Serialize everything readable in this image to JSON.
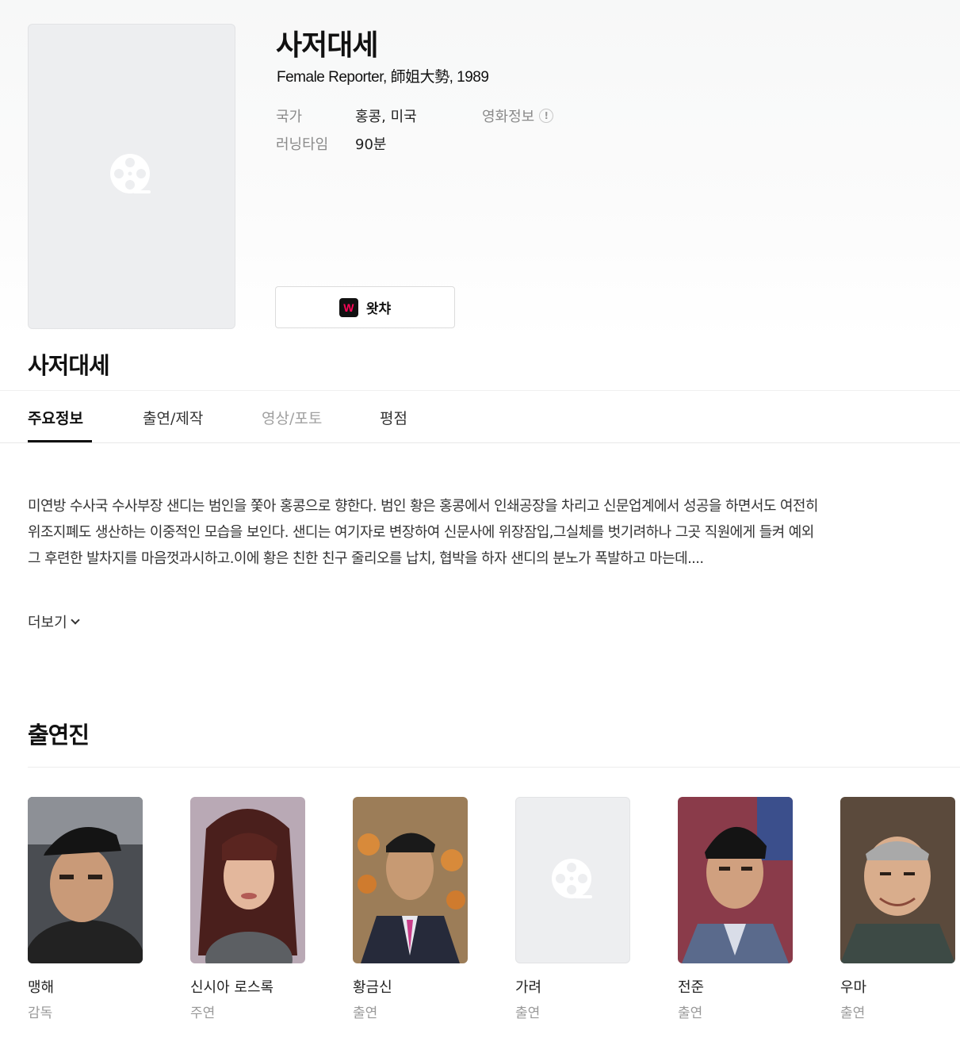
{
  "movie": {
    "title": "사저대세",
    "subtitle": "Female Reporter, 師姐大勢, 1989",
    "meta": [
      {
        "label": "국가",
        "value": "홍콩, 미국"
      },
      {
        "label": "러닝타임",
        "value": "90분"
      }
    ],
    "info_link": "영화정보",
    "info_icon_glyph": "!",
    "watch_button": {
      "logo": "W",
      "label": "왓챠",
      "logo_color": "#ff0558"
    }
  },
  "title_secondary": "사저대세",
  "tabs": [
    {
      "label": "주요정보",
      "state": "active"
    },
    {
      "label": "출연/제작",
      "state": "normal"
    },
    {
      "label": "영상/포토",
      "state": "disabled"
    },
    {
      "label": "평점",
      "state": "normal"
    }
  ],
  "synopsis": "미연방 수사국 수사부장 샌디는 범인을 쫓아 홍콩으로 향한다. 범인 황은 홍콩에서 인쇄공장을 차리고 신문업계에서 성공을 하면서도 여전히 위조지폐도 생산하는 이중적인 모습을 보인다. 샌디는 여기자로 변장하여 신문사에 위장잠입,그실체를 벗기려하나 그곳 직원에게 들켜 예외 그 후련한 발차지를 마음껏과시하고.이에 황은 친한 친구 줄리오를 납치, 협박을 하자 샌디의 분노가 폭발하고 마는데....",
  "more_label": "더보기",
  "cast_section_title": "출연진",
  "cast": [
    {
      "name": "맹해",
      "role": "감독",
      "photo": "portrait"
    },
    {
      "name": "신시아 로스록",
      "role": "주연",
      "photo": "portrait"
    },
    {
      "name": "황금신",
      "role": "출연",
      "photo": "portrait"
    },
    {
      "name": "가려",
      "role": "출연",
      "photo": "placeholder"
    },
    {
      "name": "전준",
      "role": "출연",
      "photo": "portrait"
    },
    {
      "name": "우마",
      "role": "출연",
      "photo": "portrait"
    }
  ]
}
